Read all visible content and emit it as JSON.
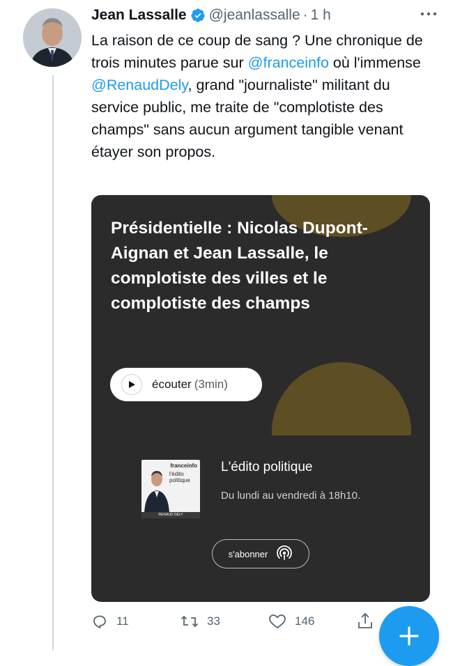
{
  "tweet": {
    "author_name": "Jean Lassalle",
    "handle": "@jeanlassalle",
    "separator": "·",
    "time": "1 h",
    "text_parts": [
      "La raison de ce coup de sang ? Une chronique de trois minutes parue sur ",
      "@franceinfo",
      " où l'immense ",
      "@RenaudDely",
      ", grand \"journaliste\" militant du service public, me traite de \"complotiste des champs\" sans aucun argument tangible venant étayer son propos."
    ]
  },
  "card": {
    "title": "Présidentielle : Nicolas Dupont-Aignan et Jean Lassalle, le complotiste des villes et le complotiste des champs",
    "listen_label": "écouter",
    "listen_duration": "(3min)",
    "podcast": {
      "thumb_brand": "franceinfo",
      "thumb_title": "l'édito politique",
      "thumb_host": "RENAUD DÉLY",
      "title": "L'édito politique",
      "schedule": "Du lundi au vendredi à 18h10."
    },
    "subscribe_label": "s'abonner",
    "accent_color": "#5e4e24"
  },
  "actions": {
    "replies": "11",
    "retweets": "33",
    "likes": "146"
  },
  "colors": {
    "link": "#1d9bf0",
    "secondary_text": "#536471",
    "card_bg": "#2b2b2b"
  }
}
